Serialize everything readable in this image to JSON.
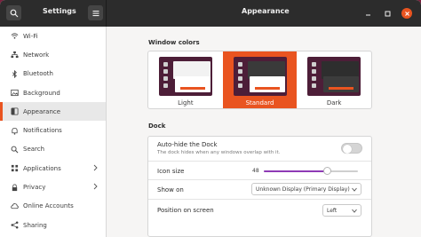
{
  "titlebar": {
    "app_title": "Settings",
    "page_title": "Appearance"
  },
  "sidebar": {
    "items": [
      {
        "label": "Wi-Fi",
        "icon": "wifi-icon"
      },
      {
        "label": "Network",
        "icon": "network-icon"
      },
      {
        "label": "Bluetooth",
        "icon": "bluetooth-icon"
      },
      {
        "label": "Background",
        "icon": "background-icon"
      },
      {
        "label": "Appearance",
        "icon": "appearance-icon",
        "active": true
      },
      {
        "label": "Notifications",
        "icon": "bell-icon"
      },
      {
        "label": "Search",
        "icon": "search-icon"
      },
      {
        "label": "Applications",
        "icon": "applications-icon",
        "chevron": true
      },
      {
        "label": "Privacy",
        "icon": "privacy-icon",
        "chevron": true
      },
      {
        "label": "Online Accounts",
        "icon": "online-accounts-icon"
      },
      {
        "label": "Sharing",
        "icon": "sharing-icon"
      }
    ]
  },
  "window_colors": {
    "heading": "Window colors",
    "options": [
      {
        "label": "Light"
      },
      {
        "label": "Standard",
        "selected": true
      },
      {
        "label": "Dark"
      }
    ]
  },
  "dock": {
    "heading": "Dock",
    "autohide": {
      "label": "Auto-hide the Dock",
      "description": "The dock hides when any windows overlap with it.",
      "enabled": false
    },
    "icon_size": {
      "label": "Icon size",
      "value": "48",
      "slider_fraction": 0.67
    },
    "show_on": {
      "label": "Show on",
      "value": "Unknown Display (Primary Display)"
    },
    "position": {
      "label": "Position on screen",
      "value": "Left"
    }
  },
  "colors": {
    "accent": "#e95420",
    "slider": "#8e3bb5",
    "titlebar": "#2c2c2c",
    "desktop": "#7a1f3d"
  }
}
